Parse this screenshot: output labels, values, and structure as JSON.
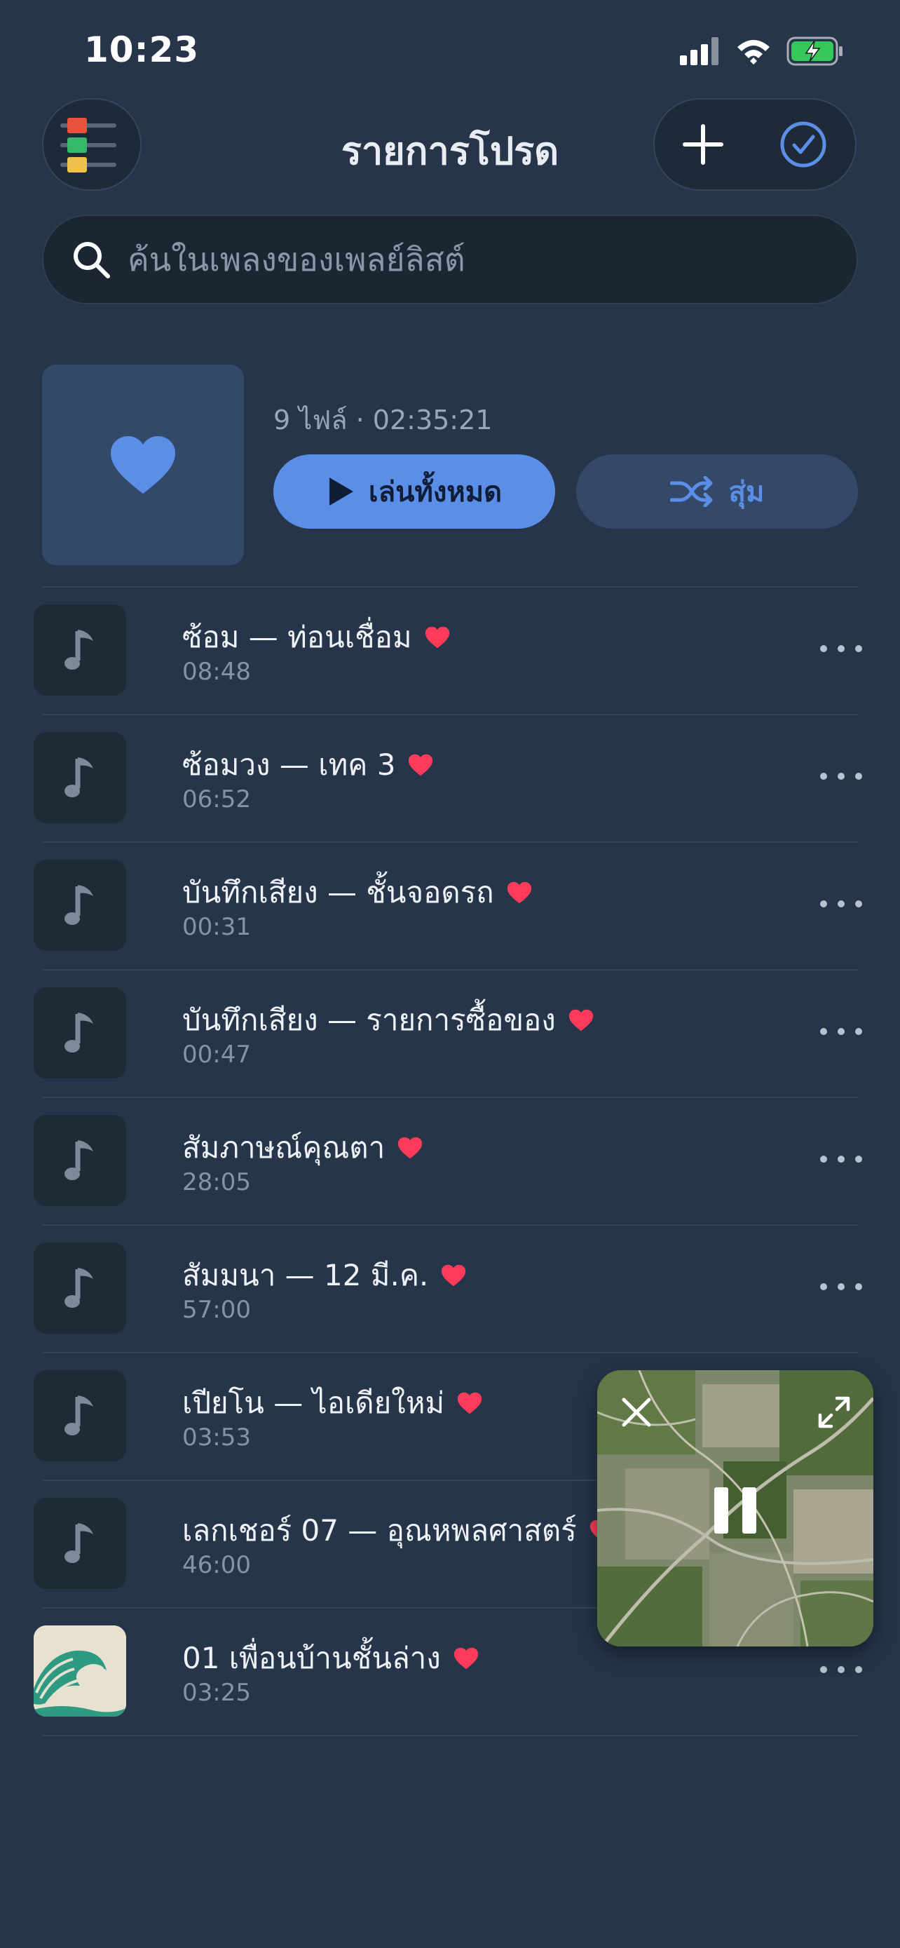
{
  "status_bar": {
    "time": "10:23"
  },
  "header": {
    "title": "รายการโปรด"
  },
  "search": {
    "placeholder": "ค้นในเพลงของเพลย์ลิสต์"
  },
  "playlist": {
    "meta": "9 ไฟล์ · 02:35:21",
    "play_all_label": "เล่นทั้งหมด",
    "shuffle_label": "สุ่ม"
  },
  "tracks": [
    {
      "title": "ซ้อม — ท่อนเชื่อม",
      "duration": "08:48",
      "favorite": true,
      "thumb": "music-note-icon"
    },
    {
      "title": "ซ้อมวง — เทค 3",
      "duration": "06:52",
      "favorite": true,
      "thumb": "music-note-icon"
    },
    {
      "title": "บันทึกเสียง — ชั้นจอดรถ",
      "duration": "00:31",
      "favorite": true,
      "thumb": "music-note-icon"
    },
    {
      "title": "บันทึกเสียง — รายการซื้อของ",
      "duration": "00:47",
      "favorite": true,
      "thumb": "music-note-icon"
    },
    {
      "title": "สัมภาษณ์คุณตา",
      "duration": "28:05",
      "favorite": true,
      "thumb": "music-note-icon"
    },
    {
      "title": "สัมมนา — 12 มี.ค.",
      "duration": "57:00",
      "favorite": true,
      "thumb": "music-note-icon"
    },
    {
      "title": "เปียโน — ไอเดียใหม่",
      "duration": "03:53",
      "favorite": true,
      "thumb": "music-note-icon"
    },
    {
      "title": "เลกเชอร์ 07 — อุณหพลศาสตร์",
      "duration": "46:00",
      "favorite": true,
      "thumb": "music-note-icon"
    },
    {
      "title": "01 เพื่อนบ้านชั้นล่าง",
      "duration": "03:25",
      "favorite": true,
      "thumb": "wave-artwork"
    }
  ],
  "mini_player": {
    "state": "playing"
  },
  "colors": {
    "background": "#263549",
    "accent": "#5b8ee6",
    "heart": "#ff3b5c"
  }
}
